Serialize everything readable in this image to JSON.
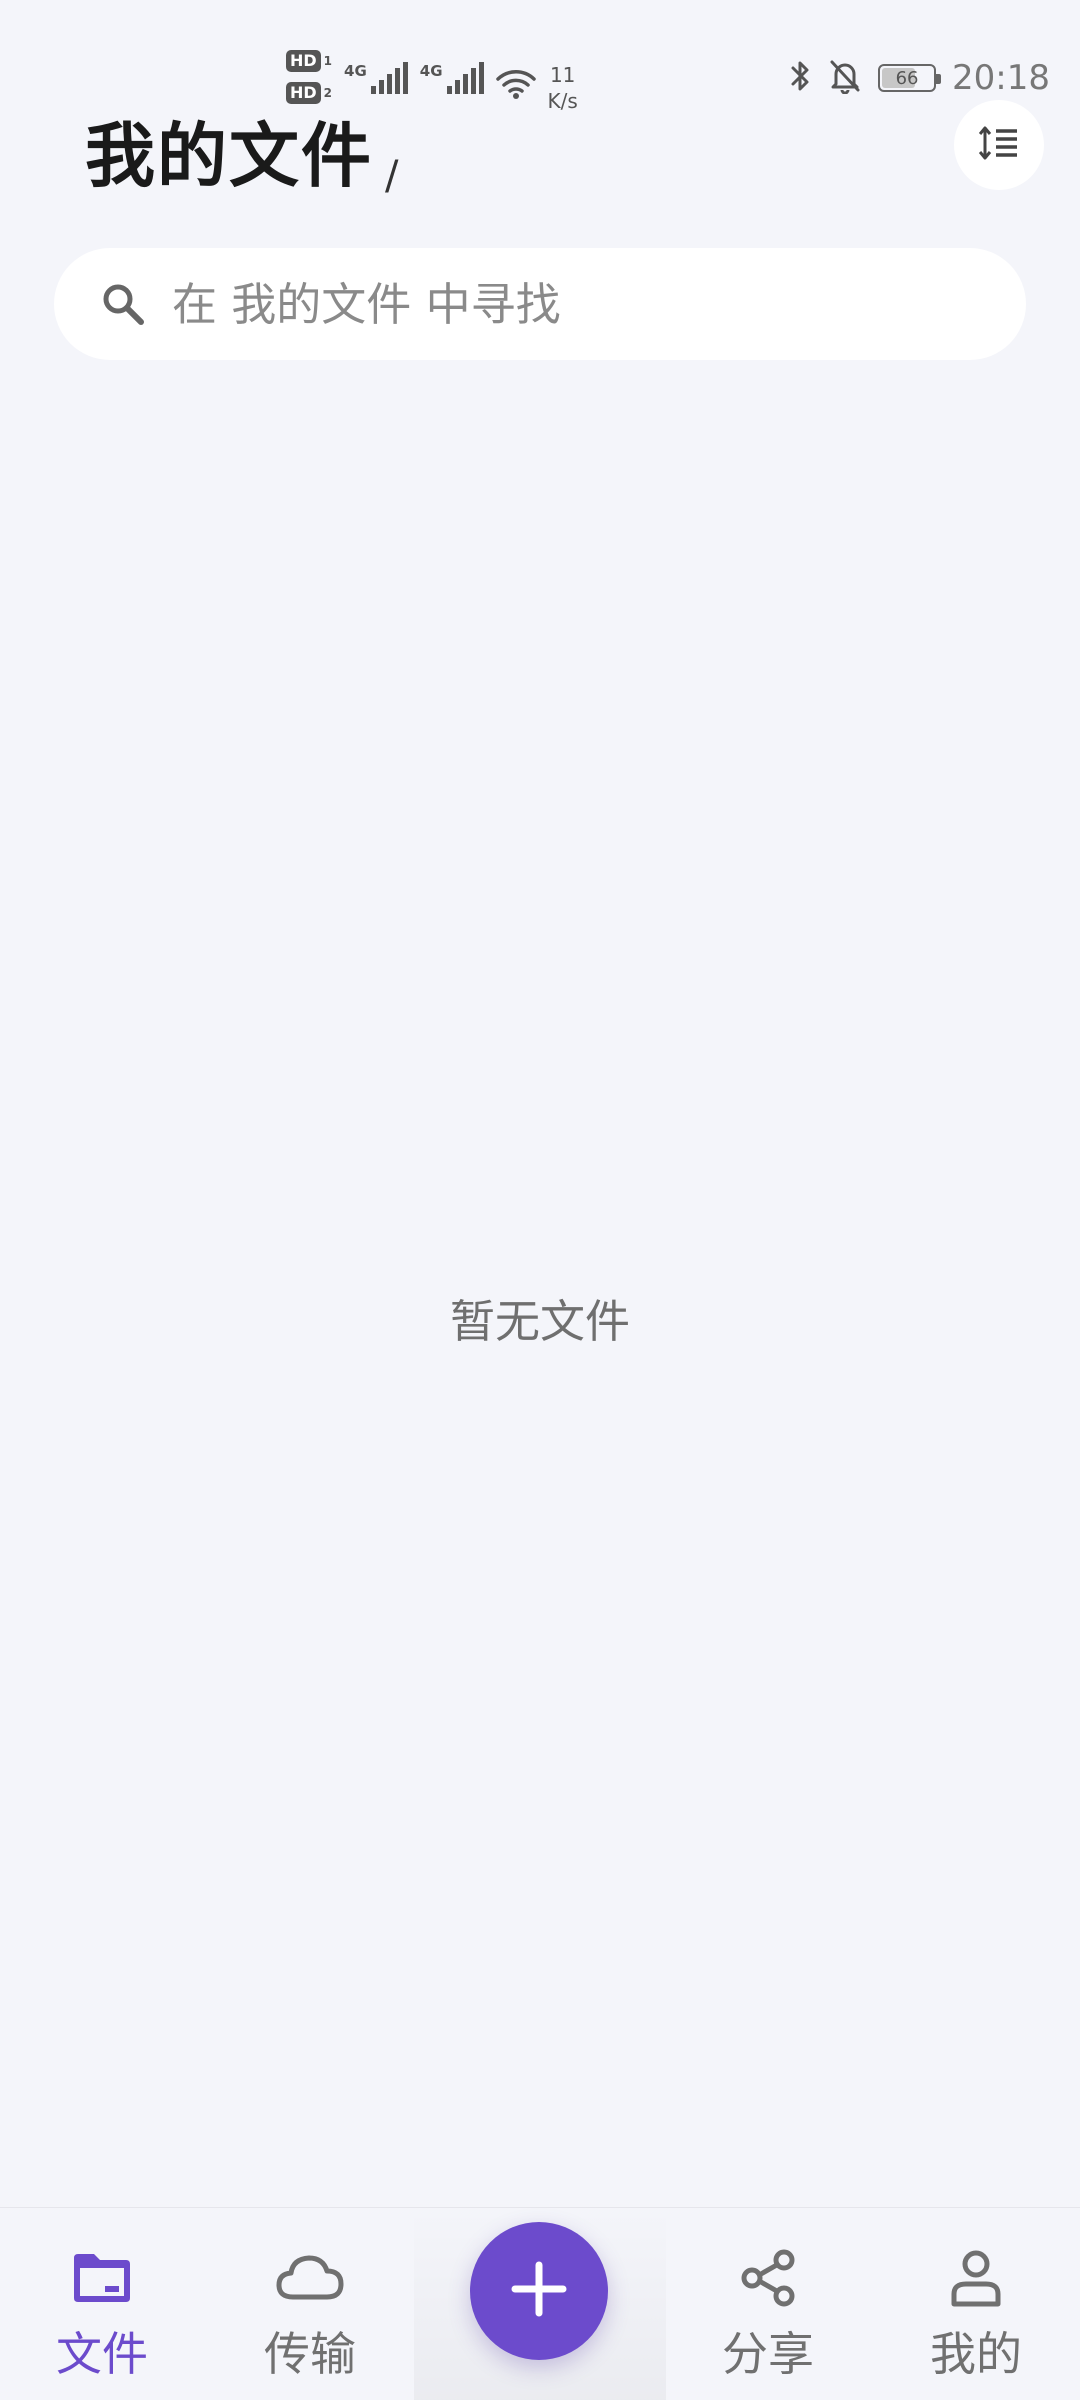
{
  "status_bar": {
    "sim1_label": "HD",
    "sim1_index": "1",
    "sim2_label": "HD",
    "sim2_index": "2",
    "network1": "4G",
    "network2": "4G",
    "speed_value": "11",
    "speed_unit": "K/s",
    "battery_level": "66",
    "time": "20:18",
    "icons": [
      "bluetooth-icon",
      "notifications-off-icon",
      "wifi-icon",
      "signal-icon",
      "battery-icon"
    ]
  },
  "header": {
    "title": "我的文件",
    "path_separator": "/",
    "sort_icon": "sort-list-icon"
  },
  "search": {
    "placeholder": "在 我的文件 中寻找",
    "icon": "search-icon"
  },
  "main": {
    "empty_text": "暂无文件"
  },
  "bottom_nav": {
    "items": [
      {
        "label": "文件",
        "icon": "folder-icon",
        "active": true
      },
      {
        "label": "传输",
        "icon": "cloud-icon",
        "active": false
      },
      {
        "label": "分享",
        "icon": "share-icon",
        "active": false
      },
      {
        "label": "我的",
        "icon": "person-icon",
        "active": false
      }
    ],
    "fab_icon": "plus-icon"
  },
  "colors": {
    "accent": "#6c4bcc",
    "background": "#f4f5fa",
    "inactive": "#707070"
  }
}
